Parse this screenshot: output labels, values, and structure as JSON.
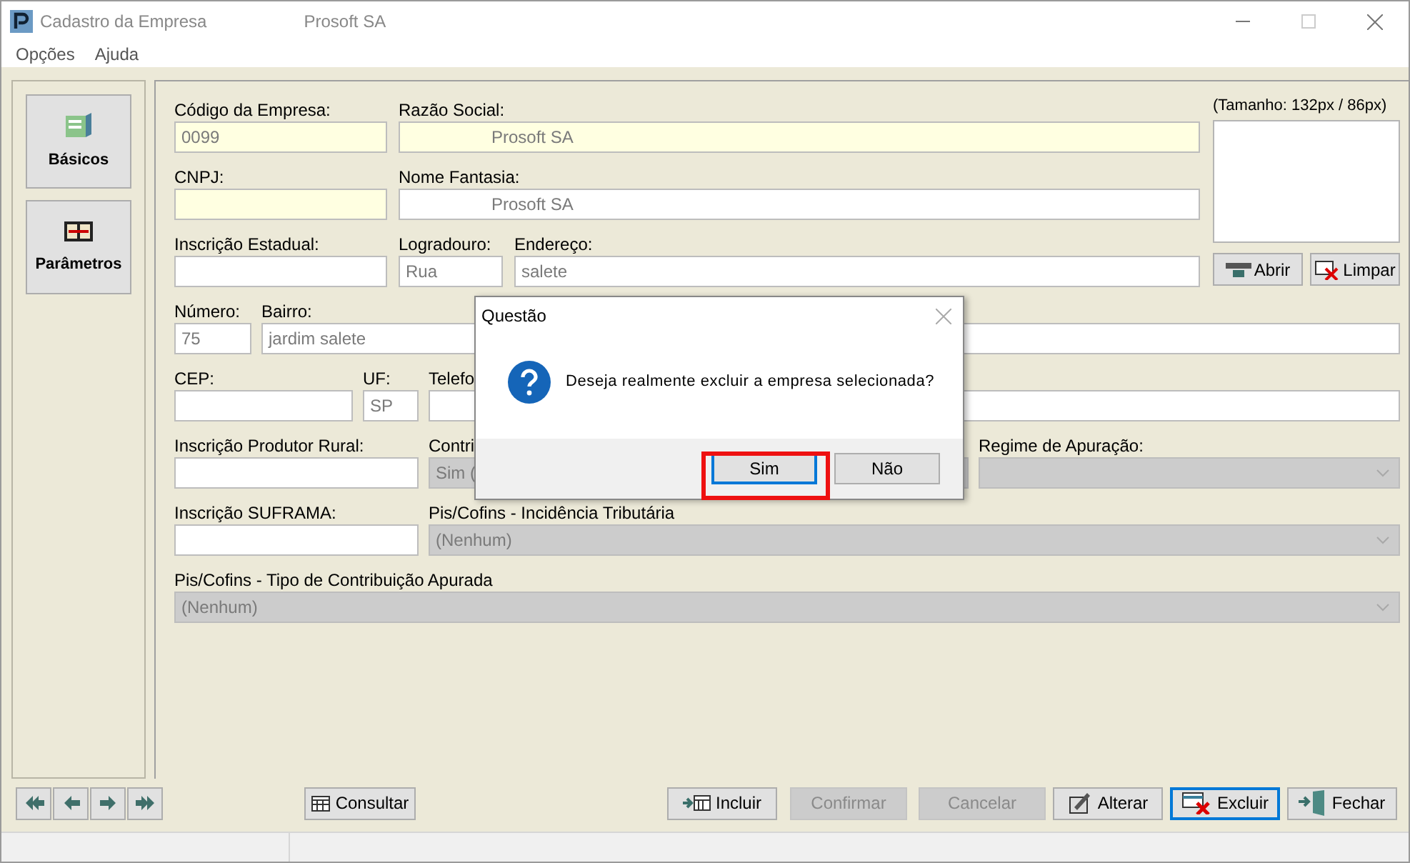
{
  "window": {
    "title": "Cadastro da Empresa",
    "subtitle": "Prosoft SA"
  },
  "menu": [
    "Opções",
    "Ajuda"
  ],
  "sidebar": [
    {
      "label": "Básicos",
      "kind": "basic"
    },
    {
      "label": "Parâmetros",
      "kind": "params"
    }
  ],
  "image_panel": {
    "caption": "(Tamanho: 132px / 86px)",
    "buttons": [
      {
        "label": "Abrir",
        "kind": "open"
      },
      {
        "label": "Limpar",
        "kind": "clear"
      }
    ]
  },
  "top_rows": [
    [
      {
        "label": "Código da Empresa:",
        "value": "0099",
        "highlighted": true
      },
      {
        "label": "Razão Social:",
        "value": "Prosoft SA",
        "highlighted": true
      }
    ],
    [
      {
        "label": "CNPJ:",
        "highlighted": true
      },
      {
        "label": "Nome Fantasia:",
        "value": "Prosoft SA",
        "highlighted": false
      }
    ],
    [
      {
        "label": "Inscrição Estadual:",
        "highlighted": false
      },
      {
        "label": "Logradouro:",
        "value": "Rua",
        "highlighted": false
      },
      {
        "label": "Endereço:",
        "value": "salete",
        "highlighted": false
      }
    ]
  ],
  "rows": [
    [
      {
        "kind": "text",
        "label": "Número:",
        "value": "75"
      },
      {
        "kind": "text",
        "label": "Bairro:",
        "value": "jardim salete"
      },
      {
        "kind": "text"
      }
    ],
    [
      {
        "kind": "text",
        "label": "CEP:"
      },
      {
        "kind": "text",
        "label": "UF:",
        "value": "SP"
      },
      {
        "kind": "text",
        "label": "Telefo"
      },
      {
        "kind": "text"
      }
    ],
    [
      {
        "kind": "text",
        "label": "Inscrição Produtor Rural:",
        "disabled": false
      },
      {
        "kind": "combo_partial",
        "label": "Contri",
        "value": "Sim (",
        "disabled": true
      },
      {
        "kind": "combo",
        "label": "Regime de Apuração:",
        "disabled": true
      }
    ],
    [
      {
        "kind": "text",
        "label": "Inscrição SUFRAMA:",
        "disabled": false
      },
      {
        "kind": "combo",
        "label": "Pis/Cofins - Incidência Tributária",
        "value": "(Nenhum)",
        "disabled": true
      }
    ],
    [
      {
        "kind": "combo",
        "label": "Pis/Cofins - Tipo de Contribuição Apurada",
        "value": "(Nenhum)",
        "disabled": true
      }
    ]
  ],
  "nav_buttons": [
    {
      "kind": "first"
    },
    {
      "kind": "prev"
    },
    {
      "kind": "next"
    },
    {
      "kind": "last"
    }
  ],
  "query_button": {
    "label": "Consultar"
  },
  "actions": [
    {
      "label": "Incluir",
      "kind": "add",
      "disabled": false,
      "focused": false
    },
    {
      "label": "Confirmar",
      "kind": "confirm",
      "disabled": true,
      "focused": false
    },
    {
      "label": "Cancelar",
      "kind": "cancel",
      "disabled": true,
      "focused": false
    },
    {
      "label": "Alterar",
      "kind": "edit",
      "disabled": false,
      "focused": false
    },
    {
      "label": "Excluir",
      "kind": "delete",
      "disabled": false,
      "focused": true
    },
    {
      "label": "Fechar",
      "kind": "close",
      "disabled": false,
      "focused": false
    }
  ],
  "dialog": {
    "title": "Questão",
    "message": "Deseja realmente excluir a empresa selecionada?",
    "buttons": [
      {
        "label": "Sim",
        "selected": true
      },
      {
        "label": "Não",
        "selected": false
      }
    ]
  }
}
